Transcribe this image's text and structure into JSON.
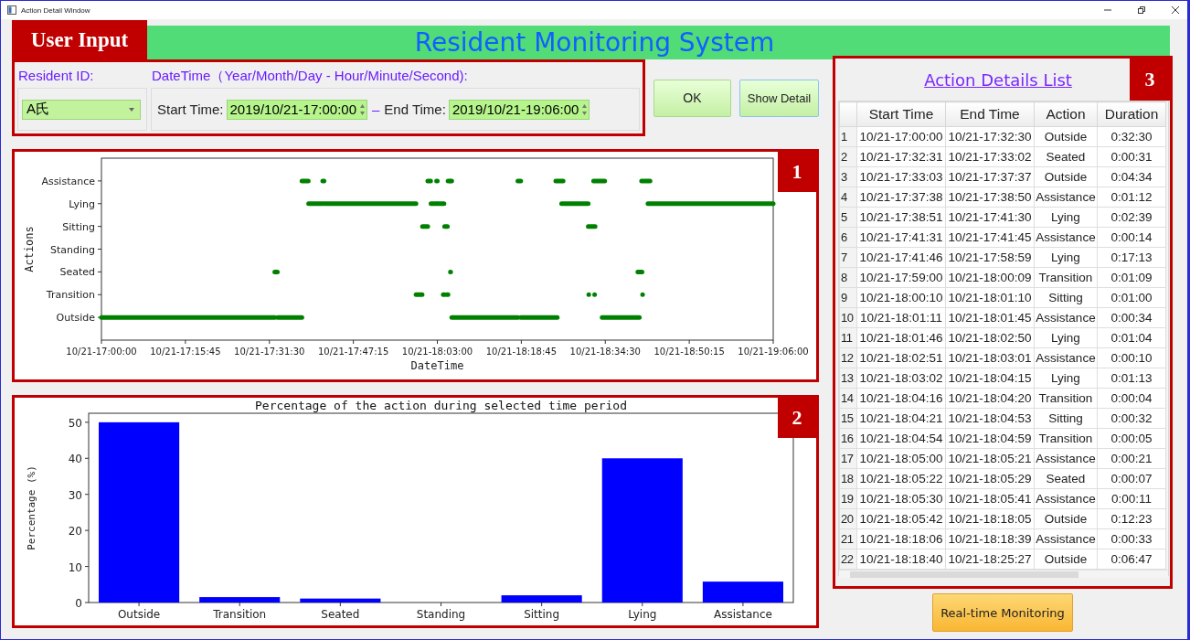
{
  "window": {
    "title": "Action Detail Window"
  },
  "header": {
    "badge": "User Input",
    "title": "Resident Monitoring System"
  },
  "user_input": {
    "resident_label": "Resident ID:",
    "resident_value": "A氏",
    "datetime_label": "DateTime（Year/Month/Day - Hour/Minute/Second):",
    "start_label": "Start Time:",
    "start_value": "2019/10/21-17:00:00",
    "separator": "–",
    "end_label": "End Time:",
    "end_value": "2019/10/21-19:06:00"
  },
  "buttons": [
    {
      "label": "OK",
      "kind": "ok"
    },
    {
      "label": "Show Detail",
      "kind": "detail"
    }
  ],
  "timeline": {
    "badge": "1",
    "plot": {
      "xlabel": "DateTime",
      "ylabel": "Actions",
      "y_labels": [
        "Assistance",
        "Lying",
        "Sitting",
        "Standing",
        "Seated",
        "Transition",
        "Outside"
      ],
      "x_labels": [
        "10/21-17:00:00",
        "10/21-17:15:45",
        "10/21-17:31:30",
        "10/21-17:47:15",
        "10/21-18:03:00",
        "10/21-18:18:45",
        "10/21-18:34:30",
        "10/21-18:50:15",
        "10/21-19:06:00"
      ]
    }
  },
  "percentage": {
    "badge": "2",
    "chart_data": {
      "type": "bar",
      "title": "Percentage of the action during selected time period",
      "ylabel": "Percentage (%)",
      "categories": [
        "Outside",
        "Transition",
        "Seated",
        "Standing",
        "Sitting",
        "Lying",
        "Assistance"
      ],
      "ylim": [
        0,
        52.5
      ],
      "yticks": [
        0,
        10,
        20,
        30,
        40,
        50
      ],
      "series": [
        {
          "color": "#0000ff",
          "values": [
            50,
            1.5,
            1.1,
            0,
            2,
            40,
            5.8
          ]
        }
      ]
    }
  },
  "details": {
    "badge": "3",
    "title": "Action Details List",
    "columns": [
      "Start Time",
      "End Time",
      "Action",
      "Duration"
    ],
    "rows": [
      {
        "index": "1",
        "cells": [
          "10/21-17:00:00",
          "10/21-17:32:30",
          "Outside",
          "0:32:30"
        ]
      },
      {
        "index": "2",
        "cells": [
          "10/21-17:32:31",
          "10/21-17:33:02",
          "Seated",
          "0:00:31"
        ]
      },
      {
        "index": "3",
        "cells": [
          "10/21-17:33:03",
          "10/21-17:37:37",
          "Outside",
          "0:04:34"
        ]
      },
      {
        "index": "4",
        "cells": [
          "10/21-17:37:38",
          "10/21-17:38:50",
          "Assistance",
          "0:01:12"
        ]
      },
      {
        "index": "5",
        "cells": [
          "10/21-17:38:51",
          "10/21-17:41:30",
          "Lying",
          "0:02:39"
        ]
      },
      {
        "index": "6",
        "cells": [
          "10/21-17:41:31",
          "10/21-17:41:45",
          "Assistance",
          "0:00:14"
        ]
      },
      {
        "index": "7",
        "cells": [
          "10/21-17:41:46",
          "10/21-17:58:59",
          "Lying",
          "0:17:13"
        ]
      },
      {
        "index": "8",
        "cells": [
          "10/21-17:59:00",
          "10/21-18:00:09",
          "Transition",
          "0:01:09"
        ]
      },
      {
        "index": "9",
        "cells": [
          "10/21-18:00:10",
          "10/21-18:01:10",
          "Sitting",
          "0:01:00"
        ]
      },
      {
        "index": "10",
        "cells": [
          "10/21-18:01:11",
          "10/21-18:01:45",
          "Assistance",
          "0:00:34"
        ]
      },
      {
        "index": "11",
        "cells": [
          "10/21-18:01:46",
          "10/21-18:02:50",
          "Lying",
          "0:01:04"
        ]
      },
      {
        "index": "12",
        "cells": [
          "10/21-18:02:51",
          "10/21-18:03:01",
          "Assistance",
          "0:00:10"
        ]
      },
      {
        "index": "13",
        "cells": [
          "10/21-18:03:02",
          "10/21-18:04:15",
          "Lying",
          "0:01:13"
        ]
      },
      {
        "index": "14",
        "cells": [
          "10/21-18:04:16",
          "10/21-18:04:20",
          "Transition",
          "0:00:04"
        ]
      },
      {
        "index": "15",
        "cells": [
          "10/21-18:04:21",
          "10/21-18:04:53",
          "Sitting",
          "0:00:32"
        ]
      },
      {
        "index": "16",
        "cells": [
          "10/21-18:04:54",
          "10/21-18:04:59",
          "Transition",
          "0:00:05"
        ]
      },
      {
        "index": "17",
        "cells": [
          "10/21-18:05:00",
          "10/21-18:05:21",
          "Assistance",
          "0:00:21"
        ]
      },
      {
        "index": "18",
        "cells": [
          "10/21-18:05:22",
          "10/21-18:05:29",
          "Seated",
          "0:00:07"
        ]
      },
      {
        "index": "19",
        "cells": [
          "10/21-18:05:30",
          "10/21-18:05:41",
          "Assistance",
          "0:00:11"
        ]
      },
      {
        "index": "20",
        "cells": [
          "10/21-18:05:42",
          "10/21-18:18:05",
          "Outside",
          "0:12:23"
        ]
      },
      {
        "index": "21",
        "cells": [
          "10/21-18:18:06",
          "10/21-18:18:39",
          "Assistance",
          "0:00:33"
        ]
      },
      {
        "index": "22",
        "cells": [
          "10/21-18:18:40",
          "10/21-18:25:27",
          "Outside",
          "0:06:47"
        ]
      }
    ]
  },
  "realtime_button": "Real-time Monitoring"
}
